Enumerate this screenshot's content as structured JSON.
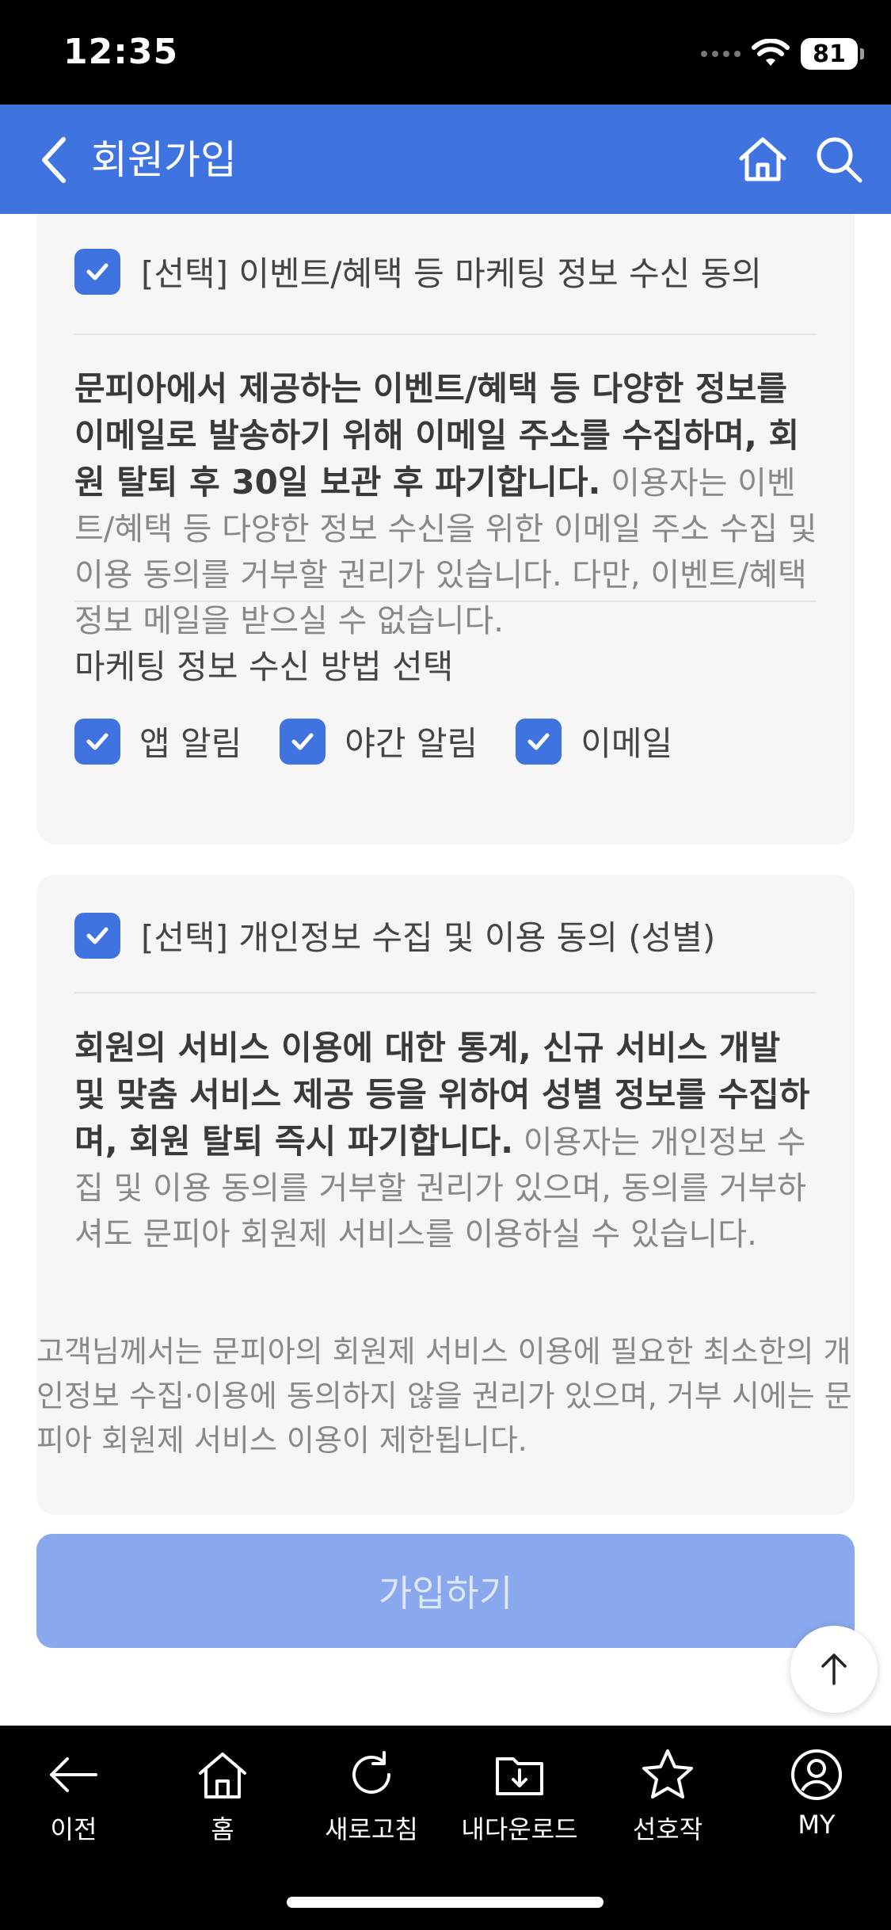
{
  "status_bar": {
    "time": "12:35",
    "battery": "81"
  },
  "header": {
    "title": "회원가입"
  },
  "marketing": {
    "consent_label": "[선택] 이벤트/혜택 등 마케팅 정보 수신 동의",
    "desc_bold": "문피아에서 제공하는 이벤트/혜택 등 다양한 정보를 이메일로 발송하기 위해 이메일 주소를 수집하며, 회원 탈퇴 후 30일 보관 후 파기합니다.",
    "desc_normal": " 이용자는 이벤트/혜택 등 다양한 정보 수신을 위한 이메일 주소 수집 및 이용 동의를 거부할 권리가 있습니다. 다만, 이벤트/혜택 정보 메일을 받으실 수 없습니다.",
    "method_title": "마케팅 정보 수신 방법 선택",
    "methods": [
      {
        "label": "앱 알림",
        "checked": true
      },
      {
        "label": "야간 알림",
        "checked": true
      },
      {
        "label": "이메일",
        "checked": true
      }
    ]
  },
  "gender": {
    "consent_label": "[선택] 개인정보 수집 및 이용 동의 (성별)",
    "desc_bold": "회원의 서비스 이용에 대한 통계, 신규 서비스 개발 및 맞춤 서비스 제공 등을 위하여 성별 정보를 수집하며, 회원 탈퇴 즉시 파기합니다.",
    "desc_normal": " 이용자는 개인정보 수집 및 이용 동의를 거부할 권리가 있으며, 동의를 거부하셔도 문피아 회원제 서비스를 이용하실 수 있습니다."
  },
  "notice": "고객님께서는 문피아의 회원제 서비스 이용에 필요한 최소한의 개인정보 수집·이용에 동의하지 않을 권리가 있으며, 거부 시에는 문피아 회원제 서비스 이용이 제한됩니다.",
  "join_button": "가입하기",
  "bottom_nav": [
    {
      "label": "이전",
      "icon": "arrow-left-icon"
    },
    {
      "label": "홈",
      "icon": "home-icon"
    },
    {
      "label": "새로고침",
      "icon": "refresh-icon"
    },
    {
      "label": "내다운로드",
      "icon": "folder-download-icon"
    },
    {
      "label": "선호작",
      "icon": "star-icon"
    },
    {
      "label": "MY",
      "icon": "user-icon"
    }
  ],
  "colors": {
    "accent": "#3f74e0",
    "button_disabled": "#8aa8ee",
    "card_bg": "#f6f6f7"
  }
}
